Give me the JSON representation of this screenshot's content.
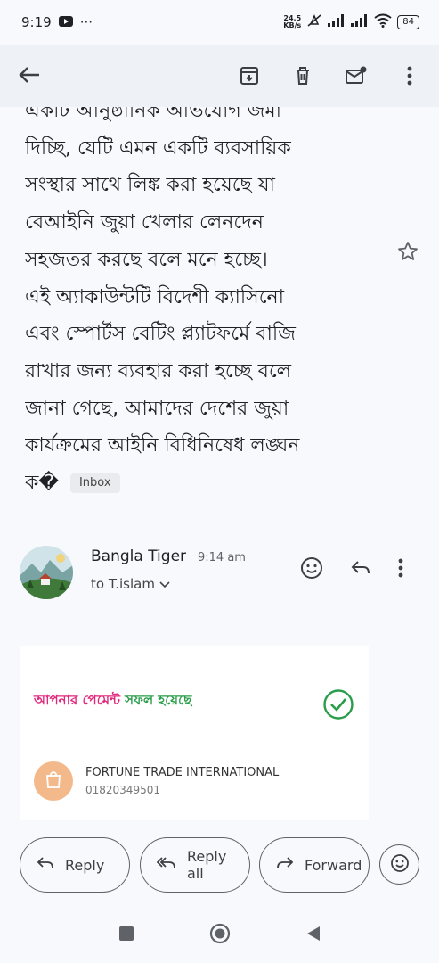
{
  "status_bar": {
    "time": "9:19",
    "net_speed_value": "24.5",
    "net_speed_unit": "KB/s",
    "battery": "84"
  },
  "email": {
    "body_lines": [
      "একটি আনুষ্ঠানিক অভিযোগ জমা",
      "দিচ্ছি, যেটি এমন একটি ব্যবসায়িক",
      "সংস্থার সাথে লিঙ্ক করা হয়েছে যা",
      "বেআইনি জুয়া খেলার লেনদেন",
      "সহজতর করছে বলে মনে হচ্ছে।",
      "এই অ্যাকাউন্টটি বিদেশী ক্যাসিনো",
      "এবং স্পোর্টস বেটিং প্ল্যাটফর্মে বাজি",
      "রাখার জন্য ব্যবহার করা হচ্ছে বলে",
      "জানা গেছে, আমাদের দেশের জুয়া",
      "কার্যক্রমের আইনি বিধিনিষেধ লঙ্ঘন"
    ],
    "last_line": "ক�",
    "label": "Inbox"
  },
  "sender": {
    "name": "Bangla Tiger",
    "time": "9:14 am",
    "to": "to T.islam"
  },
  "receipt": {
    "title_part1": "আপনার পেমেন্ট",
    "title_part2": "সফল হয়েছে",
    "merchant_name": "FORTUNE TRADE INTERNATIONAL",
    "merchant_phone": "01820349501"
  },
  "actions": {
    "reply": "Reply",
    "reply_all": "Reply all",
    "forward": "Forward"
  },
  "colors": {
    "pink": "#e0287c",
    "green": "#2a9d4a",
    "topbar": "#eef1f6"
  }
}
